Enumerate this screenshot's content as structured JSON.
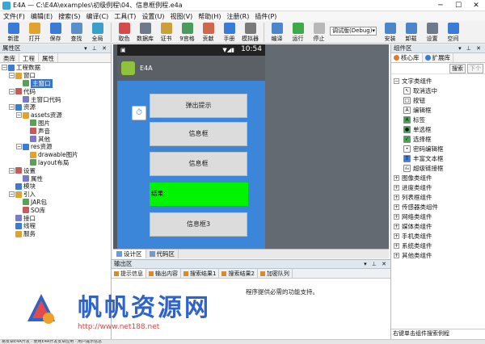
{
  "window": {
    "title": "E4A — C:\\E4A\\examples\\初级例程\\04、信息框例程.e4a"
  },
  "menu": [
    "文件(F)",
    "编辑(E)",
    "搜索(S)",
    "编译(C)",
    "工具(T)",
    "设置(U)",
    "视图(V)",
    "帮助(H)",
    "注册(R)",
    "插件(P)"
  ],
  "toolbar": {
    "buttons": [
      {
        "label": "新建",
        "icon": "new-icon",
        "color": "#3a7bd5"
      },
      {
        "label": "打开",
        "icon": "open-icon",
        "color": "#e0a330"
      },
      {
        "label": "保存",
        "icon": "save-icon",
        "color": "#3a7bd5"
      },
      {
        "label": "查找",
        "icon": "find-icon",
        "color": "#5a8fc9"
      },
      {
        "label": "全局",
        "icon": "global-icon",
        "color": "#3aa0c9"
      },
      {
        "label": "取色",
        "icon": "color-picker-icon",
        "color": "#d44b4b"
      },
      {
        "label": "数据库",
        "icon": "database-icon",
        "color": "#6c7a89"
      },
      {
        "label": "证书",
        "icon": "certificate-icon",
        "color": "#c9a03a"
      },
      {
        "label": "9宫格",
        "icon": "grid-icon",
        "color": "#4a9b5e"
      },
      {
        "label": "贡献",
        "icon": "contribute-icon",
        "color": "#d0664a"
      },
      {
        "label": "手册",
        "icon": "manual-icon",
        "color": "#3a7bd5"
      },
      {
        "label": "模拟器",
        "icon": "emulator-icon",
        "color": "#7a7a7a"
      },
      {
        "label": "编译",
        "icon": "compile-icon",
        "color": "#4a86c9"
      },
      {
        "label": "运行",
        "icon": "run-icon",
        "color": "#3faa4b"
      },
      {
        "label": "停止",
        "icon": "stop-icon",
        "color": "#b8b8b8"
      }
    ],
    "mode_select": "调试版(Debug)",
    "buttons_right": [
      {
        "label": "安装",
        "icon": "install-icon",
        "color": "#4a86c9"
      },
      {
        "label": "卸载",
        "icon": "uninstall-icon",
        "color": "#4a86c9"
      },
      {
        "label": "设置",
        "icon": "settings-icon",
        "color": "#6c7a89"
      },
      {
        "label": "空间",
        "icon": "space-icon",
        "color": "#3a7bd5"
      }
    ]
  },
  "left_panel": {
    "title": "属性区",
    "tabs": [
      "类库",
      "工程",
      "属性"
    ],
    "tree": [
      {
        "label": "工程数据",
        "level": 0,
        "toggle": "−"
      },
      {
        "label": "窗口",
        "level": 1,
        "toggle": "−"
      },
      {
        "label": "主窗口",
        "level": 2,
        "selected": true
      },
      {
        "label": "代码",
        "level": 1,
        "toggle": "−"
      },
      {
        "label": "主窗口代码",
        "level": 2
      },
      {
        "label": "资源",
        "level": 1,
        "toggle": "−"
      },
      {
        "label": "assets资源",
        "level": 2,
        "toggle": "−"
      },
      {
        "label": "图片",
        "level": 3
      },
      {
        "label": "声音",
        "level": 3
      },
      {
        "label": "其他",
        "level": 3
      },
      {
        "label": "res资源",
        "level": 2,
        "toggle": "−"
      },
      {
        "label": "drawable图片",
        "level": 3
      },
      {
        "label": "layout布局",
        "level": 3
      },
      {
        "label": "设置",
        "level": 1,
        "toggle": "−"
      },
      {
        "label": "属性",
        "level": 2
      },
      {
        "label": "模块",
        "level": 1
      },
      {
        "label": "引入",
        "level": 1,
        "toggle": "−"
      },
      {
        "label": "JAR包",
        "level": 2
      },
      {
        "label": "SO库",
        "level": 2
      },
      {
        "label": "接口",
        "level": 1
      },
      {
        "label": "线程",
        "level": 1
      },
      {
        "label": "服务",
        "level": 1
      }
    ]
  },
  "designer": {
    "time": "10:54",
    "app_name": "E4A",
    "buttons": [
      "弹出提示",
      "信息框",
      "信息框",
      "信息框3"
    ],
    "result_label": "结果:"
  },
  "center_tabs": [
    "设计区",
    "代码区"
  ],
  "output": {
    "title": "输出区",
    "tabs": [
      "提示信息",
      "输出内容",
      "搜索结果1",
      "搜索结果2",
      "加密队列"
    ],
    "message": "程序提供必需的功能支持。"
  },
  "right_panel": {
    "title": "组件区",
    "tabs": [
      "核心库",
      "扩展库"
    ],
    "search_label": "搜索",
    "next_label": "下个",
    "groups": [
      {
        "label": "文字类组件",
        "expanded": true,
        "items": [
          "取消选中",
          "按钮",
          "编辑框",
          "标签",
          "单选框",
          "选择框",
          "密码编辑框",
          "丰富文本框",
          "超级链接框"
        ]
      },
      {
        "label": "图像类组件"
      },
      {
        "label": "进度类组件"
      },
      {
        "label": "列表框组件"
      },
      {
        "label": "传感器类组件"
      },
      {
        "label": "网络类组件"
      },
      {
        "label": "媒体类组件"
      },
      {
        "label": "手机类组件"
      },
      {
        "label": "系统类组件"
      },
      {
        "label": "其他类组件"
      }
    ],
    "footer": "右键单击组件搜索例程"
  },
  "watermark": {
    "title": "帆帆资源网",
    "url": "http://www.net188.net"
  },
  "statusline": "易安卓E4A开发 · 使用E4A开发安卓应用 · 用户提示信息"
}
